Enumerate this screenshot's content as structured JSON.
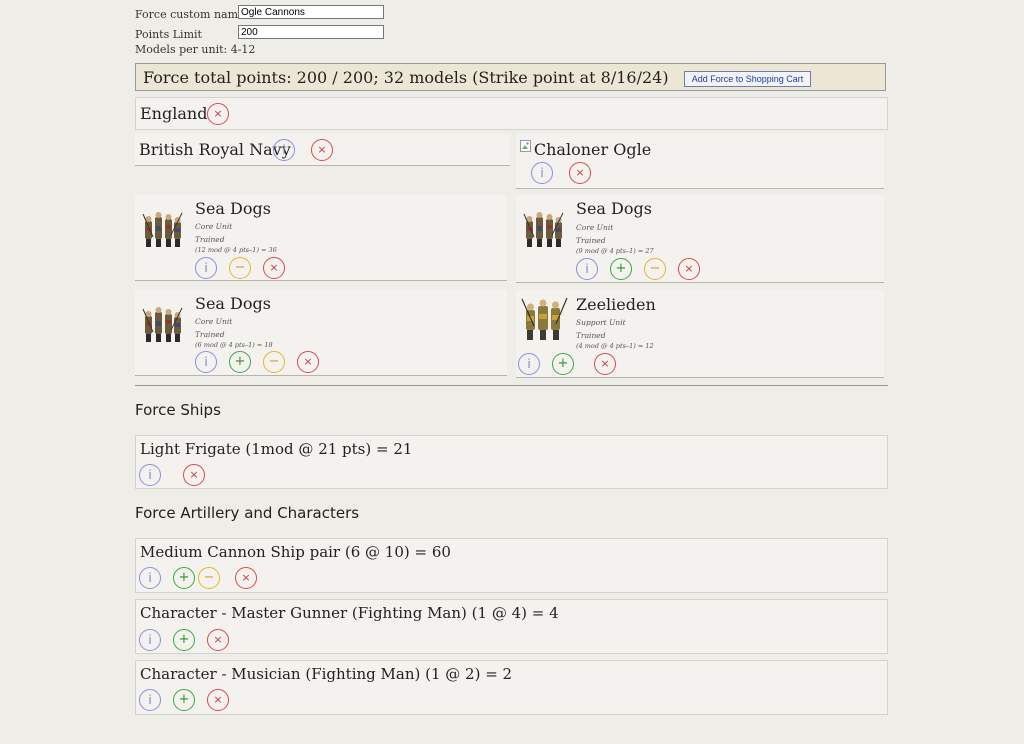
{
  "form": {
    "custom_name_label": "Force custom name:",
    "custom_name_value": "Ogle Cannons",
    "points_limit_label": "Points Limit",
    "points_limit_value": "200",
    "models_per_unit": "Models per unit: 4-12"
  },
  "totals": {
    "text": "Force total points: 200 / 200; 32 models (Strike point at 8/16/24)",
    "cart_button": "Add Force to Shopping Cart"
  },
  "nation": {
    "name": "England"
  },
  "faction": {
    "name": "British Royal Navy"
  },
  "commander": {
    "name": "Chaloner Ogle"
  },
  "units": [
    {
      "name": "Sea Dogs",
      "type": "Core Unit",
      "skill": "Trained",
      "cost": "(12 mod @ 4 pts–1) = 36"
    },
    {
      "name": "Sea Dogs",
      "type": "Core Unit",
      "skill": "Trained",
      "cost": "(9 mod @ 4 pts–1) = 27"
    },
    {
      "name": "Sea Dogs",
      "type": "Core Unit",
      "skill": "Trained",
      "cost": "(6 mod @ 4 pts–1) = 18"
    },
    {
      "name": "Zeelieden",
      "type": "Support Unit",
      "skill": "Trained",
      "cost": "(4 mod @ 4 pts–1) = 12"
    }
  ],
  "ships": {
    "heading": "Force Ships",
    "items": [
      {
        "label": "Light Frigate (1mod @ 21 pts) = 21"
      }
    ]
  },
  "artillery": {
    "heading": "Force Artillery and Characters",
    "items": [
      {
        "label": "Medium Cannon Ship pair (6 @ 10) = 60"
      },
      {
        "label": "Character - Master Gunner (Fighting Man) (1 @ 4) = 4"
      },
      {
        "label": "Character - Musician (Fighting Man) (1 @ 2) = 2"
      }
    ]
  },
  "glyphs": {
    "info": "i",
    "plus": "+",
    "minus": "−",
    "del": "×"
  },
  "colors": {
    "info": "#8a8ee0",
    "plus": "#3ea644",
    "minus": "#e3b62c",
    "del": "#d94a4a",
    "totals_bg": "#ece7d4",
    "page_bg": "#efede8"
  },
  "icons": {
    "unit_image": "miniature-soldiers-icon",
    "broken_image": "broken-image-icon"
  }
}
